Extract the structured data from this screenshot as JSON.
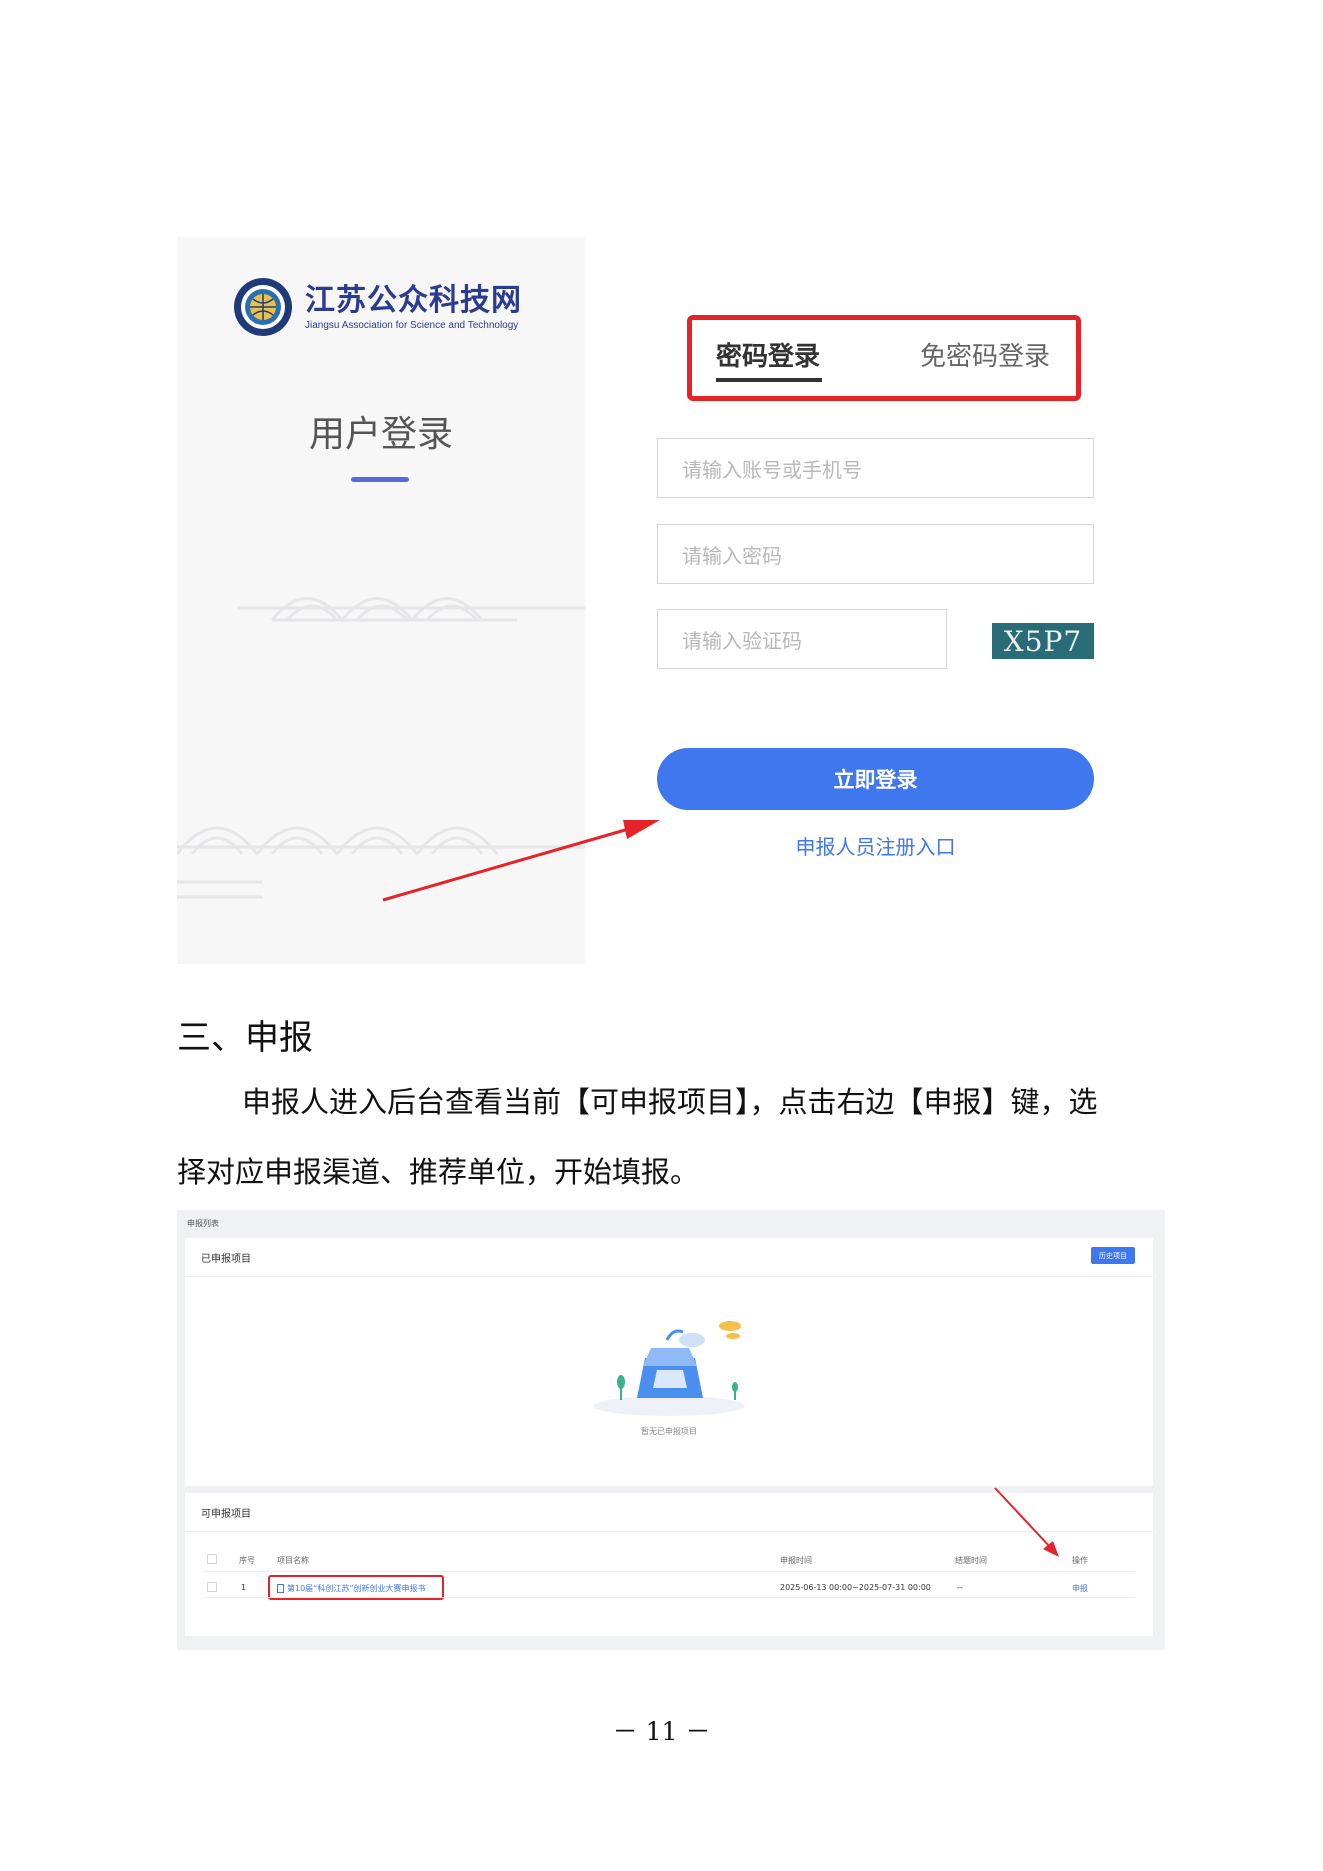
{
  "login": {
    "logo_name": "江苏公众科技网",
    "logo_en": "Jiangsu Association for Science and Technology",
    "heading": "用户登录",
    "tab_password": "密码登录",
    "tab_passwordless": "免密码登录",
    "account_placeholder": "请输入账号或手机号",
    "password_placeholder": "请输入密码",
    "captcha_placeholder": "请输入验证码",
    "captcha_text": "X5P7",
    "login_button": "立即登录",
    "register_link": "申报人员注册入口",
    "colors": {
      "primary": "#3f77ee",
      "highlight": "#e5242a"
    }
  },
  "section": {
    "heading": "三、申报",
    "paragraph_line1": "申报人进入后台查看当前【可申报项目】，点击右边【申报】键，选",
    "paragraph_line2": "择对应申报渠道、推荐单位，开始填报。"
  },
  "list": {
    "breadcrumb": "申报列表",
    "declared_title": "已申报项目",
    "history_button": "历史项目",
    "empty_text": "暂无已申报项目",
    "available_title": "可申报项目",
    "columns": [
      "序号",
      "项目名称",
      "申报时间",
      "结题时间",
      "操作"
    ],
    "rows": [
      {
        "index": "1",
        "name": "第10届“科创江苏”创新创业大赛申报书",
        "declare_time": "2025-06-13 00:00~2025-07-31 00:00",
        "end_time": "--",
        "action": "申报"
      }
    ]
  },
  "page_number": "－ 11 －"
}
